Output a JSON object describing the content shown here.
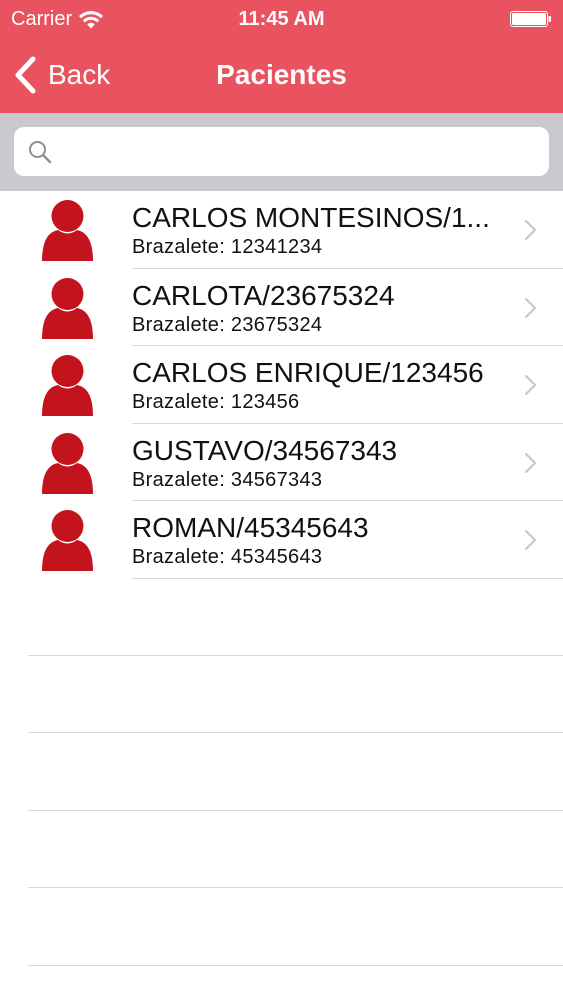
{
  "status_bar": {
    "carrier": "Carrier",
    "time": "11:45 AM",
    "wifi_icon": "wifi-icon",
    "battery_icon": "battery-icon"
  },
  "nav": {
    "back_label": "Back",
    "title": "Pacientes",
    "back_icon": "chevron-left-icon"
  },
  "search": {
    "placeholder": "",
    "value": "",
    "icon": "search-icon"
  },
  "patients": [
    {
      "name": "CARLOS MONTESINOS/1...",
      "bracelet": "Brazalete: 12341234"
    },
    {
      "name": "CARLOTA/23675324",
      "bracelet": "Brazalete: 23675324"
    },
    {
      "name": "CARLOS ENRIQUE/123456",
      "bracelet": "Brazalete: 123456"
    },
    {
      "name": "GUSTAVO/34567343",
      "bracelet": "Brazalete: 34567343"
    },
    {
      "name": "ROMAN/45345643",
      "bracelet": "Brazalete: 45345643"
    }
  ],
  "colors": {
    "header": "#e9535f",
    "avatar": "#c3141d",
    "search_bar_bg": "#c9c9ce",
    "separator": "#d9d9d9",
    "chevron": "#c7c7cc"
  }
}
